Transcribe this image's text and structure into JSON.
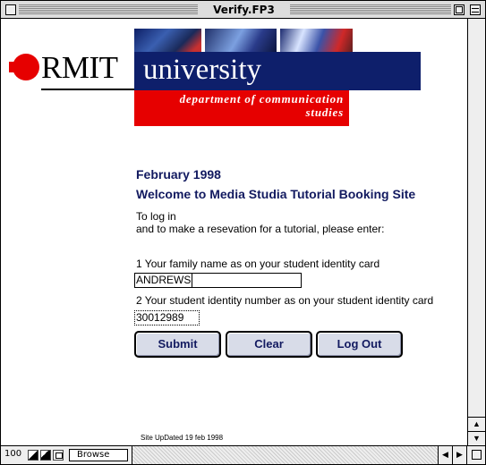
{
  "window": {
    "title": "Verify.FP3"
  },
  "logo": {
    "rmit": "RMIT",
    "university": "university",
    "department_line1": "department of communication",
    "department_line2": "studies"
  },
  "page": {
    "date": "February 1998",
    "welcome": "Welcome to Media Studia Tutorial Booking Site",
    "intro_line1": "To log in",
    "intro_line2": "and to make a resevation for a tutorial, please enter:",
    "field1_label": "1  Your family name as on your student identity card",
    "field1_value": "ANDREWS",
    "field2_label": "2  Your student identity number as on your student identity card",
    "field2_value": "30012989",
    "footer": "Site UpDated 19 feb 1998"
  },
  "buttons": {
    "submit": "Submit",
    "clear": "Clear",
    "logout": "Log Out"
  },
  "statusbar": {
    "zoom": "100",
    "mode": "Browse"
  },
  "colors": {
    "heading": "#121a60",
    "rmit_red": "#e60000",
    "navy": "#0e1f6b"
  },
  "icons": {
    "scroll_up": "up-arrow-icon",
    "scroll_down": "down-arrow-icon",
    "scroll_left": "left-arrow-icon",
    "scroll_right": "right-arrow-icon"
  }
}
